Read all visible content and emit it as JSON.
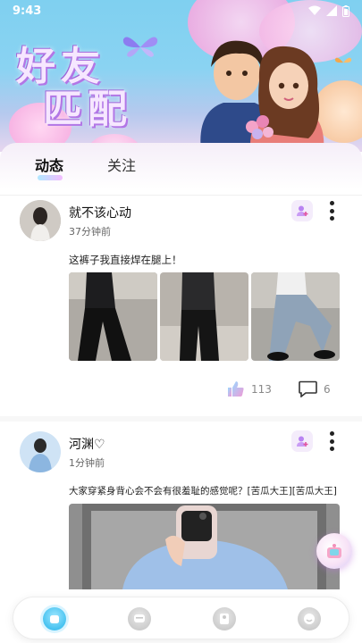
{
  "status_bar": {
    "time": "9:43"
  },
  "banner": {
    "title_line1": "好友",
    "title_line2": "匹配"
  },
  "tabs": [
    {
      "label": "动态",
      "active": true
    },
    {
      "label": "关注",
      "active": false
    }
  ],
  "posts": [
    {
      "username": "就不该心动",
      "time": "37分钟前",
      "text": "这裤子我直接焊在腿上！",
      "likes": "113",
      "comments": "6"
    },
    {
      "username": "河渊♡",
      "time": "1分钟前",
      "text": "大家穿紧身背心会不会有很羞耻的感觉呢？[苦瓜大王][苦瓜大王]"
    }
  ],
  "icons": {
    "follow": "add-friend-icon",
    "more": "more-vertical-icon",
    "like": "thumbs-up-icon",
    "comment": "comment-bubble-icon",
    "nav": [
      "home-icon",
      "messages-icon",
      "friends-icon",
      "profile-icon"
    ]
  },
  "colors": {
    "accent_blue": "#46c2f0",
    "accent_pink": "#f2b5ff",
    "banner_sky": "#7fd0f0"
  }
}
